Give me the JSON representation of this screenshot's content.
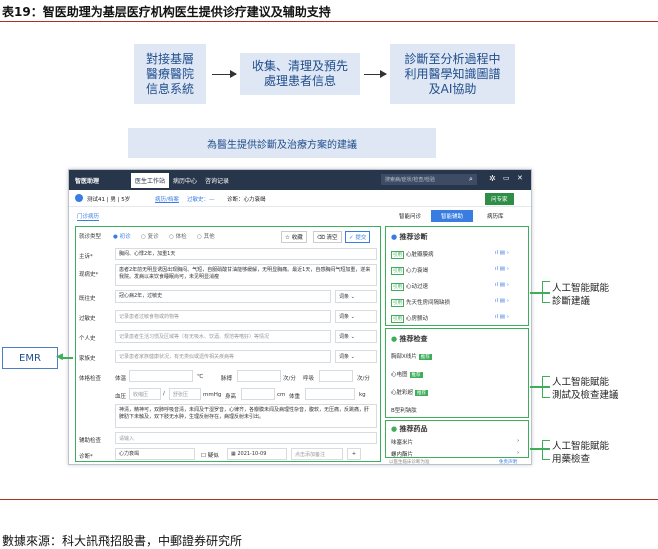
{
  "header": {
    "title": "表19：智医助理为基层医疗机构医生提供诊疗建议及辅助支持"
  },
  "flow": {
    "box1": "對接基層\n醫療醫院\n信息系統",
    "box2": "收集、清理及預先\n處理患者信息",
    "box3": "診斷至分析過程中\n利用醫學知識圖譜\n及AI協助",
    "banner": "為醫生提供診斷及治療方案的建議"
  },
  "app": {
    "logo": "智医助理",
    "nav": [
      "医生工作站",
      "病历中心",
      "咨询记录"
    ],
    "search_placeholder": "搜索病/症状/检查/检验",
    "patient": "测试41 | 男 | 5岁",
    "patient_links": [
      "病历/档案",
      "过敏史：—"
    ],
    "diagnosis_header": "诊断：心力衰竭",
    "consult_button": "问专家",
    "tab_active": "门诊病历",
    "right_tabs": [
      "智能问诊",
      "智能辅助",
      "病历库"
    ],
    "visit_type_label": "就诊类型",
    "visit_types": [
      "初诊",
      "复诊",
      "体检",
      "其他"
    ],
    "actions": [
      "收藏",
      "清空",
      "提交"
    ],
    "fields": [
      {
        "label": "主诉*",
        "value": "胸闷、心悸2年，加重1天"
      },
      {
        "label": "现病史*",
        "value": "患者2年前无明显诱因出现胸闷、气短，自服硝酸甘油能够缓解，无明显胸痛。最近1天，自感胸闷气短加重，遂来我院。发病以来饮食睡眠尚可，未见明显消瘦"
      },
      {
        "label": "既往史",
        "value": "冠心病2年，过敏史"
      },
      {
        "label": "过敏史",
        "value": "记录患者过敏食物或药物等"
      },
      {
        "label": "个人史",
        "value": "记录患者生活习惯及区域等（有无吸水、饮酒、规范等嗜好）等情况"
      },
      {
        "label": "家族史",
        "value": "记录患者家族健康状况，有无类似或遗传相关疾病等"
      }
    ],
    "dropdown": "词条",
    "exam": {
      "label": "体格检查",
      "temp_label": "体温",
      "temp_unit": "℃",
      "pulse_label": "脉搏",
      "pulse_unit": "次/分",
      "resp_label": "呼吸",
      "resp_unit": "次/分",
      "bp_label": "血压",
      "bp_sys": "收缩压",
      "bp_sep": "/",
      "bp_dia": "舒张压",
      "bp_unit": "mmHg",
      "height_label": "身高",
      "height_unit": "cm",
      "weight_label": "体重",
      "weight_unit": "kg",
      "notes": "神清，精神可，双肺呼吸音清，未闻及干湿罗音，心律齐，各瓣膜未闻及病理性杂音，腹软，无压痛，反跳痛，肝脾肋下未触及，双下肢无水肿，生理反射存在，病理反射未引出。"
    },
    "aux": {
      "label": "辅助检查",
      "placeholder": "请输入"
    },
    "diag": {
      "label": "诊断*",
      "value": "心力衰竭",
      "check": "疑似",
      "date": "2021-10-09",
      "note": "点击添加备注",
      "add": "+"
    },
    "panel": {
      "rec_diag_title": "推荐诊断",
      "rec_diag": [
        "心脏瓣膜病",
        "心力衰竭",
        "心动过速",
        "先天性房间隔缺损",
        "心房颤动"
      ],
      "rec_diag_badge": "引用",
      "rec_exam_title": "推荐检查",
      "rec_exam": [
        "胸部X线片",
        "心电图",
        "心脏彩超",
        "B型利钠肽"
      ],
      "exam_badge": "推荐",
      "rec_drug_title": "推荐药品",
      "rec_drug": [
        "味塞米片",
        "螺内酯片"
      ],
      "footer_left": "以医生临床诊断为准",
      "footer_right": "免责声明"
    }
  },
  "annotations": {
    "emr": "EMR",
    "a1": "人工智能賦能\n診斷建議",
    "a2": "人工智能賦能\n測試及檢查建議",
    "a3": "人工智能賦能\n用藥檢查"
  },
  "footer": {
    "source": "數據來源：科大訊飛招股書，中郵證券研究所"
  },
  "colors": {
    "accent_red": "#b0301e",
    "flow_fill": "#dfe6f4",
    "flow_text": "#1f4e8c",
    "green": "#3fae5b",
    "app_dark": "#28364c",
    "app_blue": "#3a7de0"
  }
}
